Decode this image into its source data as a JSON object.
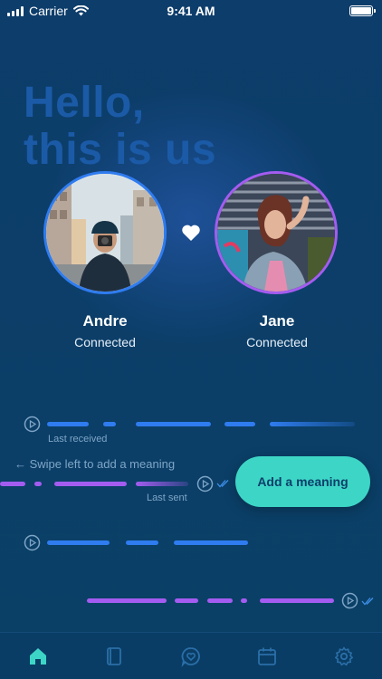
{
  "status_bar": {
    "carrier": "Carrier",
    "time": "9:41 AM"
  },
  "hero": {
    "line1": "Hello,",
    "line2": "this is us"
  },
  "people": [
    {
      "name": "Andre",
      "status": "Connected"
    },
    {
      "name": "Jane",
      "status": "Connected"
    }
  ],
  "messages": {
    "received_caption": "Last received",
    "sent_caption": "Last sent",
    "swipe_hint": "← Swipe left to add a meaning",
    "add_meaning_label": "Add a meaning"
  },
  "colors": {
    "background": "#0b3f6a",
    "received_wave": "#2f7cf0",
    "sent_wave": "#a45cf0",
    "accent_button": "#3dd6c6",
    "active_tab": "#3dd6c6",
    "inactive_tab": "#2a6fa8"
  },
  "tabs": [
    {
      "icon": "home-icon",
      "active": true
    },
    {
      "icon": "book-icon",
      "active": false
    },
    {
      "icon": "chat-heart-icon",
      "active": false
    },
    {
      "icon": "calendar-icon",
      "active": false
    },
    {
      "icon": "gear-icon",
      "active": false
    }
  ]
}
